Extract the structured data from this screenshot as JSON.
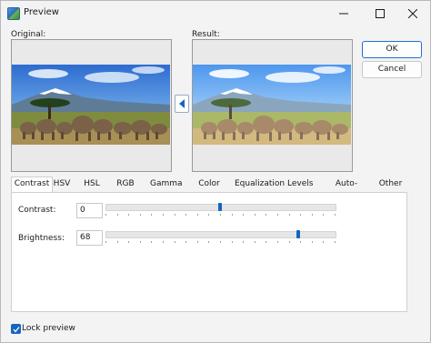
{
  "window": {
    "title": "Preview"
  },
  "titlebar_buttons": [
    {
      "name": "minimize-button",
      "icon": "minimize-icon"
    },
    {
      "name": "maximize-button",
      "icon": "maximize-icon"
    },
    {
      "name": "close-button",
      "icon": "close-icon"
    }
  ],
  "original_label": "Original:",
  "result_label": "Result:",
  "copy_arrow_icon": "arrow-left-icon",
  "buttons": {
    "ok": "OK",
    "cancel": "Cancel"
  },
  "tabs": [
    {
      "label": "Contrast",
      "active": true
    },
    {
      "label": "HSV",
      "active": false
    },
    {
      "label": "HSL",
      "active": false
    },
    {
      "label": "RGB",
      "active": false
    },
    {
      "label": "Gamma",
      "active": false
    },
    {
      "label": "Color Curve",
      "active": false
    },
    {
      "label": "Equalization",
      "active": false
    },
    {
      "label": "Levels",
      "active": false
    },
    {
      "label": "Auto-Enhance",
      "active": false
    },
    {
      "label": "Other",
      "active": false
    }
  ],
  "contrast": {
    "label": "Contrast:",
    "value": "0",
    "slider_fraction": 0.5
  },
  "brightness": {
    "label": "Brightness:",
    "value": "68",
    "slider_fraction": 0.84
  },
  "lock_preview": {
    "label": "Lock preview",
    "checked": true
  },
  "colors": {
    "accent": "#1565c0",
    "primary_border": "#1f6fd0"
  }
}
